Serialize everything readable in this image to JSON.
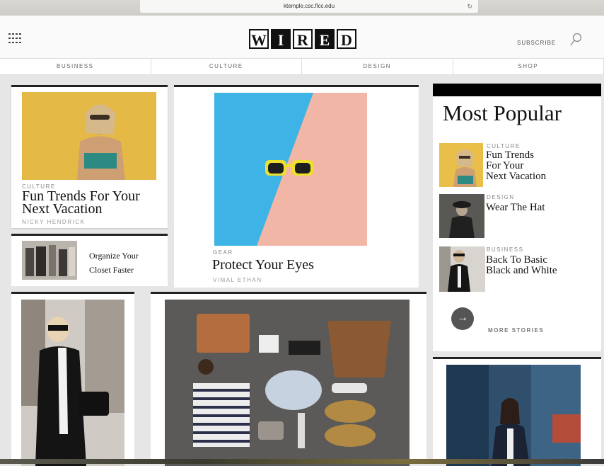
{
  "browser": {
    "url": "ktemple.csc.flcc.edu",
    "reload_icon": "↻"
  },
  "header": {
    "logo_letters": [
      "W",
      "I",
      "R",
      "E",
      "D"
    ],
    "subscribe_label": "SUBSCRIBE"
  },
  "nav": {
    "items": [
      "BUSINESS",
      "CULTURE",
      "DESIGN",
      "SHOP"
    ]
  },
  "story1": {
    "kicker": "CULTURE",
    "title_line1": "Fun Trends For Your",
    "title_line2": "Next Vacation",
    "author": "NICKY HENDRICK"
  },
  "story2": {
    "title_line1": "Organize Your",
    "title_line2": "Closet Faster"
  },
  "feature": {
    "kicker": "GEAR",
    "title": "Protect Your Eyes",
    "author": "VIMAL ETHAN"
  },
  "popular": {
    "heading": "Most Popular",
    "items": [
      {
        "kicker": "CULTURE",
        "line1": "Fun Trends",
        "line2": "For Your",
        "line3": "Next Vacation"
      },
      {
        "kicker": "DESIGN",
        "line1": "Wear The Hat",
        "line2": "",
        "line3": ""
      },
      {
        "kicker": "BUSINESS",
        "line1": "Back To Basic",
        "line2": "Black and White",
        "line3": ""
      }
    ],
    "more_label": "MORE STORIES"
  }
}
